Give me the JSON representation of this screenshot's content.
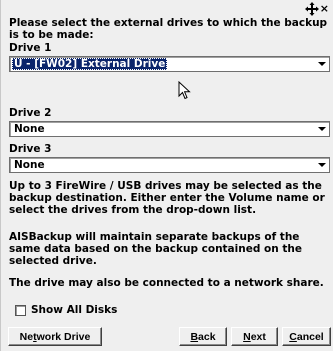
{
  "window": {
    "move_icon": "move-icon",
    "close_glyph": "×"
  },
  "intro": "Please select the external drives to which the backup is to be made:",
  "drives": [
    {
      "label": "Drive 1",
      "value": "U - [FW02] External Drive"
    },
    {
      "label": "Drive 2",
      "value": "None"
    },
    {
      "label": "Drive 3",
      "value": "None"
    }
  ],
  "info": {
    "p1": "Up to 3 FireWire / USB drives may be selected as the backup destination. Either enter the Volume name or select the drives from the drop-down list.",
    "p2": "AISBackup will maintain separate backups of the same data based on the backup contained on the selected drive.",
    "p3": "The drive may also be connected to a network share."
  },
  "show_all_disks": {
    "label": "Show All Disks",
    "checked": false
  },
  "buttons": {
    "network_drive": {
      "pre": "Ne",
      "mnemonic": "t",
      "post": "work Drive"
    },
    "back": {
      "pre": "",
      "mnemonic": "B",
      "post": "ack"
    },
    "next": {
      "pre": "",
      "mnemonic": "N",
      "post": "ext"
    },
    "cancel": {
      "pre": "",
      "mnemonic": "C",
      "post": "ancel"
    }
  },
  "colors": {
    "dialog_bg": "#efefef",
    "selection_bg": "#0a246a",
    "selection_text": "#ffffff"
  }
}
